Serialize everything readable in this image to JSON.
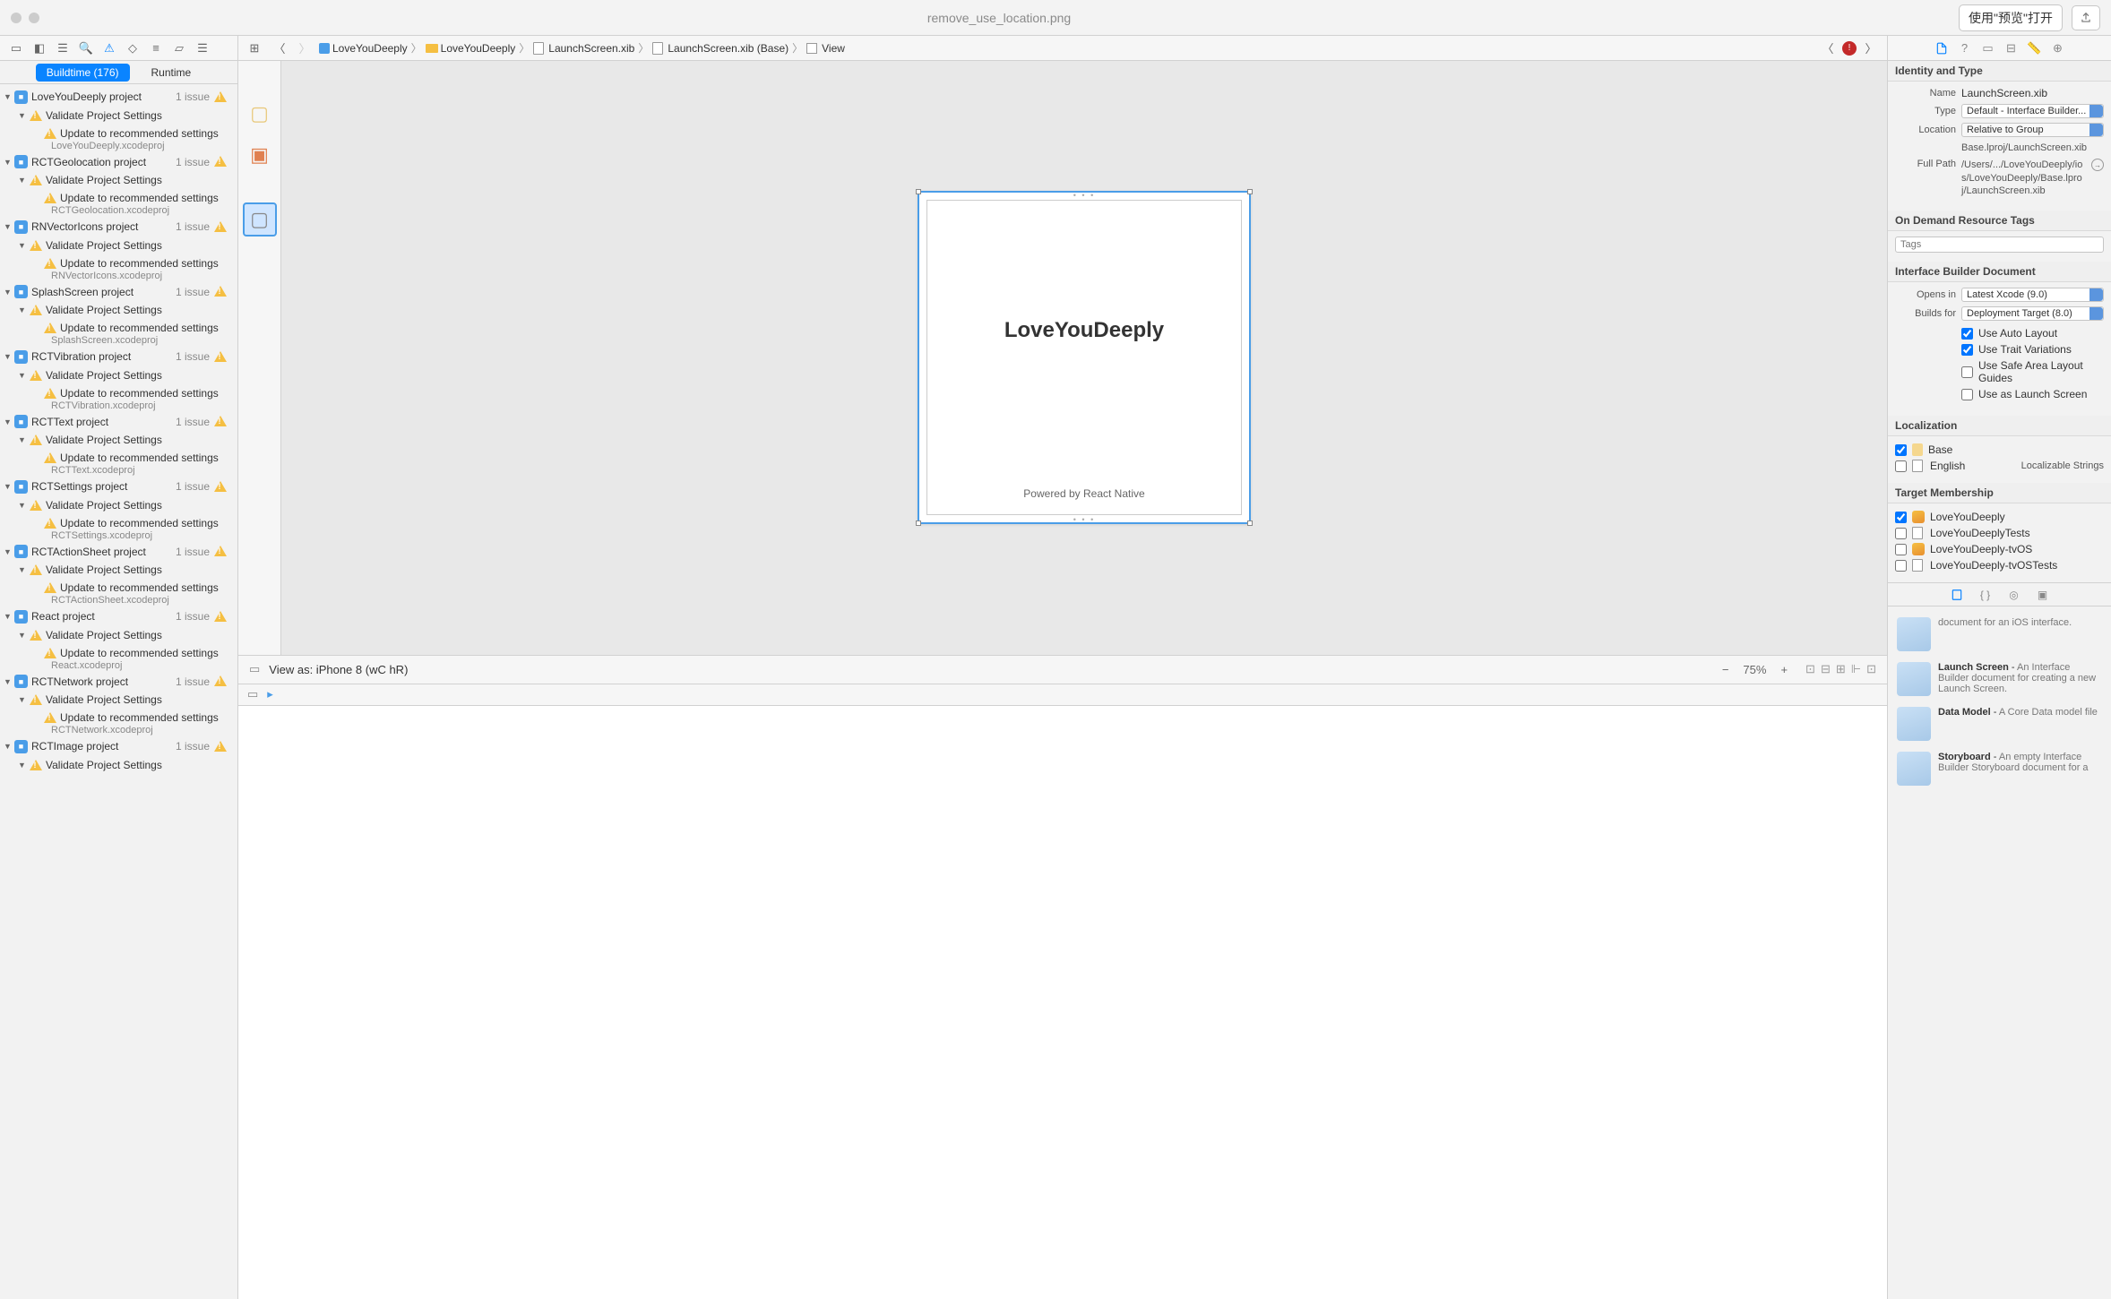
{
  "window": {
    "title": "remove_use_location.png",
    "preview_button": "使用\"预览\"打开"
  },
  "nav_toolbar": {
    "buildtime_tab": "Buildtime (176)",
    "runtime_tab": "Runtime"
  },
  "breadcrumbs": [
    {
      "icon": "proj",
      "label": "LoveYouDeeply"
    },
    {
      "icon": "folder",
      "label": "LoveYouDeeply"
    },
    {
      "icon": "file",
      "label": "LaunchScreen.xib"
    },
    {
      "icon": "file",
      "label": "LaunchScreen.xib (Base)"
    },
    {
      "icon": "view",
      "label": "View"
    }
  ],
  "issue_tree": [
    {
      "label": "LoveYouDeeply project",
      "count": "1 issue",
      "file": "LoveYouDeeply.xcodeproj"
    },
    {
      "label": "RCTGeolocation project",
      "count": "1 issue",
      "file": "RCTGeolocation.xcodeproj"
    },
    {
      "label": "RNVectorIcons project",
      "count": "1 issue",
      "file": "RNVectorIcons.xcodeproj"
    },
    {
      "label": "SplashScreen project",
      "count": "1 issue",
      "file": "SplashScreen.xcodeproj"
    },
    {
      "label": "RCTVibration project",
      "count": "1 issue",
      "file": "RCTVibration.xcodeproj"
    },
    {
      "label": "RCTText project",
      "count": "1 issue",
      "file": "RCTText.xcodeproj"
    },
    {
      "label": "RCTSettings project",
      "count": "1 issue",
      "file": "RCTSettings.xcodeproj"
    },
    {
      "label": "RCTActionSheet project",
      "count": "1 issue",
      "file": "RCTActionSheet.xcodeproj"
    },
    {
      "label": "React project",
      "count": "1 issue",
      "file": "React.xcodeproj"
    },
    {
      "label": "RCTNetwork project",
      "count": "1 issue",
      "file": "RCTNetwork.xcodeproj"
    },
    {
      "label": "RCTImage project",
      "count": "1 issue",
      "file": ""
    }
  ],
  "issue_strings": {
    "validate": "Validate Project Settings",
    "update": "Update to recommended settings"
  },
  "canvas": {
    "app_title": "LoveYouDeeply",
    "app_subtitle": "Powered by React Native",
    "view_as": "View as: iPhone 8 (wC hR)",
    "zoom": "75%"
  },
  "inspector": {
    "identity_header": "Identity and Type",
    "name_label": "Name",
    "name_value": "LaunchScreen.xib",
    "type_label": "Type",
    "type_value": "Default - Interface Builder...",
    "location_label": "Location",
    "location_value": "Relative to Group",
    "location_path": "Base.lproj/LaunchScreen.xib",
    "fullpath_label": "Full Path",
    "fullpath_value": "/Users/.../LoveYouDeeply/ios/LoveYouDeeply/Base.lproj/LaunchScreen.xib",
    "odr_header": "On Demand Resource Tags",
    "tags_placeholder": "Tags",
    "ib_header": "Interface Builder Document",
    "opens_in_label": "Opens in",
    "opens_in_value": "Latest Xcode (9.0)",
    "builds_for_label": "Builds for",
    "builds_for_value": "Deployment Target (8.0)",
    "chk_autolayout": "Use Auto Layout",
    "chk_trait": "Use Trait Variations",
    "chk_safearea": "Use Safe Area Layout Guides",
    "chk_launch": "Use as Launch Screen",
    "loc_header": "Localization",
    "loc_base": "Base",
    "loc_english": "English",
    "loc_strings": "Localizable Strings",
    "target_header": "Target Membership",
    "targets": [
      {
        "label": "LoveYouDeeply",
        "checked": true,
        "type": "app"
      },
      {
        "label": "LoveYouDeeplyTests",
        "checked": false,
        "type": "test"
      },
      {
        "label": "LoveYouDeeply-tvOS",
        "checked": false,
        "type": "app"
      },
      {
        "label": "LoveYouDeeply-tvOSTests",
        "checked": false,
        "type": "test"
      }
    ],
    "library": [
      {
        "title": "",
        "desc": "document for an iOS interface."
      },
      {
        "title": "Launch Screen",
        "desc": "An Interface Builder document for creating a new Launch Screen."
      },
      {
        "title": "Data Model",
        "desc": "A Core Data model file"
      },
      {
        "title": "Storyboard",
        "desc": "An empty Interface Builder Storyboard document for a"
      }
    ]
  }
}
